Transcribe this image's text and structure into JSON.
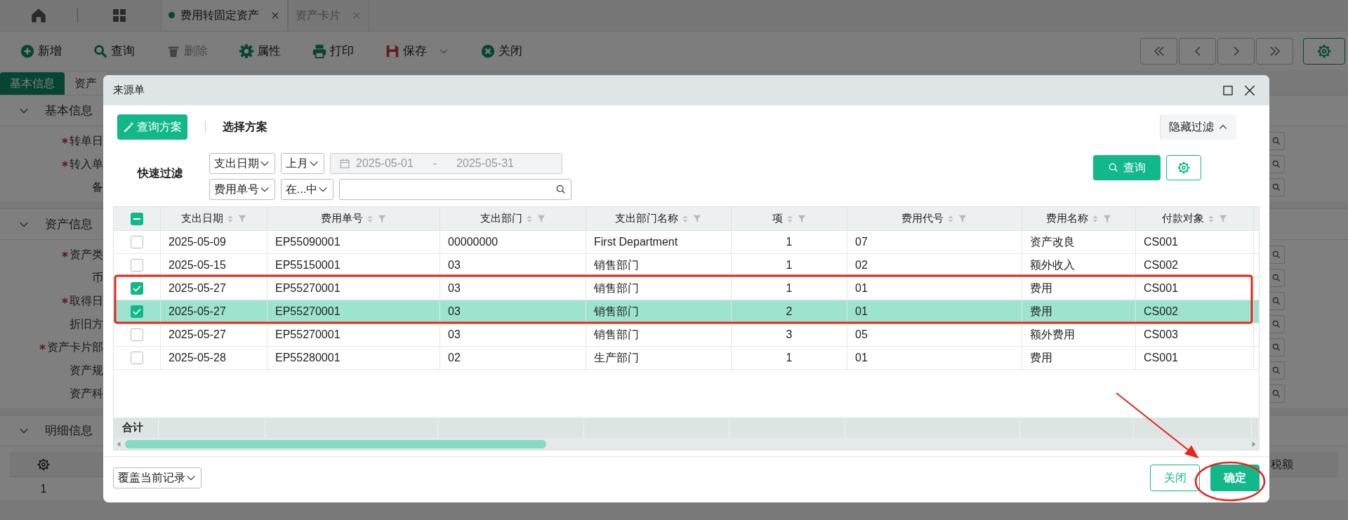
{
  "page_tabs": [
    {
      "label": "费用转固定资产",
      "selected": true,
      "unsaved": true
    },
    {
      "label": "资产卡片",
      "selected": false,
      "unsaved": false
    }
  ],
  "toolbar": [
    {
      "kind": "add",
      "label": "新增",
      "disabled": false
    },
    {
      "kind": "search",
      "label": "查询",
      "disabled": false
    },
    {
      "kind": "delete",
      "label": "删除",
      "disabled": true
    },
    {
      "kind": "settings",
      "label": "属性",
      "disabled": false
    },
    {
      "kind": "print",
      "label": "打印",
      "disabled": false
    },
    {
      "kind": "save",
      "label": "保存",
      "disabled": false
    },
    {
      "kind": "close",
      "label": "关闭",
      "disabled": false
    }
  ],
  "form_tabs": [
    {
      "label": "基本信息",
      "selected": true
    },
    {
      "label": "资产",
      "selected": false
    }
  ],
  "sections": [
    {
      "title": "基本信息",
      "fields": [
        {
          "label": "转单日",
          "required": true
        },
        {
          "label": "转入单",
          "required": true
        },
        {
          "label": "备",
          "required": false
        }
      ]
    },
    {
      "title": "资产信息",
      "fields": [
        {
          "label": "资产类",
          "required": true
        },
        {
          "label": "币",
          "required": false
        },
        {
          "label": "取得日",
          "required": true
        },
        {
          "label": "折旧方",
          "required": false
        },
        {
          "label": "资产卡片部",
          "required": true
        },
        {
          "label": "资产规",
          "required": false
        },
        {
          "label": "资产科",
          "required": false
        }
      ]
    },
    {
      "title": "明细信息"
    }
  ],
  "detail_grid": {
    "last_column": "税额",
    "row_number": "1"
  },
  "dialog": {
    "title": "来源单",
    "scheme_button": "查询方案",
    "scheme_label": "选择方案",
    "hide_filter": "隐藏过滤",
    "quick_filter_label": "快速过滤",
    "filters": [
      {
        "field": "支出日期",
        "operator": "上月",
        "kind": "date_range",
        "date_from": "2025-05-01",
        "separator": "-",
        "date_to": "2025-05-31",
        "disabled": true
      },
      {
        "field": "费用单号",
        "operator": "在...中",
        "kind": "search",
        "disabled": false
      }
    ],
    "query_button": "查询",
    "table": {
      "columns": [
        "支出日期",
        "费用单号",
        "支出部门",
        "支出部门名称",
        "项",
        "费用代号",
        "费用名称",
        "付款对象"
      ],
      "header_checkbox": {
        "indeterminate": true
      },
      "rows": [
        {
          "checked": false,
          "selected": false,
          "cells": [
            "2025-05-09",
            "EP55090001",
            "00000000",
            "First Department",
            "1",
            "07",
            "资产改良",
            "CS001"
          ]
        },
        {
          "checked": false,
          "selected": false,
          "cells": [
            "2025-05-15",
            "EP55150001",
            "03",
            "销售部门",
            "1",
            "02",
            "额外收入",
            "CS002"
          ]
        },
        {
          "checked": true,
          "selected": false,
          "cells": [
            "2025-05-27",
            "EP55270001",
            "03",
            "销售部门",
            "1",
            "01",
            "费用",
            "CS001"
          ]
        },
        {
          "checked": true,
          "selected": true,
          "cells": [
            "2025-05-27",
            "EP55270001",
            "03",
            "销售部门",
            "2",
            "01",
            "费用",
            "CS002"
          ]
        },
        {
          "checked": false,
          "selected": false,
          "cells": [
            "2025-05-27",
            "EP55270001",
            "03",
            "销售部门",
            "3",
            "05",
            "额外费用",
            "CS003"
          ]
        },
        {
          "checked": false,
          "selected": false,
          "cells": [
            "2025-05-28",
            "EP55280001",
            "02",
            "生产部门",
            "1",
            "01",
            "费用",
            "CS001"
          ]
        }
      ],
      "total_label": "合计"
    },
    "mode_select": "覆盖当前记录",
    "close_button": "关闭",
    "confirm_button": "确定"
  }
}
